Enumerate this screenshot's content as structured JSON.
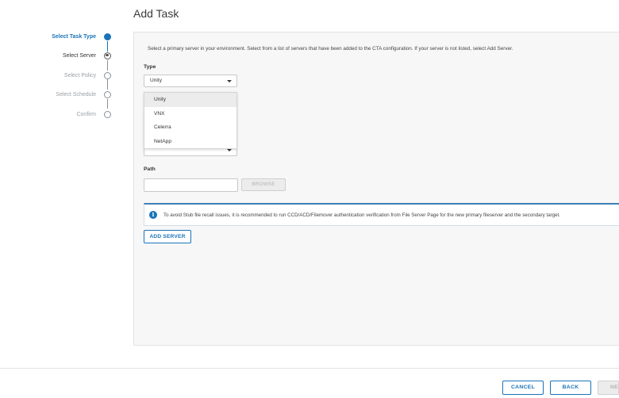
{
  "page": {
    "title": "Add Task"
  },
  "stepper": {
    "steps": [
      {
        "label": "Select Task Type",
        "state": "done"
      },
      {
        "label": "Select Server",
        "state": "current"
      },
      {
        "label": "Select Policy",
        "state": "pending"
      },
      {
        "label": "Select Schedule",
        "state": "pending"
      },
      {
        "label": "Confirm",
        "state": "pending"
      }
    ]
  },
  "form": {
    "intro": "Select a primary server in your environment. Select from a list of servers that have been added to the CTA configuration. If your server is not listed, select Add Server.",
    "type_label": "Type",
    "type_value": "Unity",
    "type_options": [
      "Unity",
      "VNX",
      "Celerra",
      "NetApp"
    ],
    "path_label": "Path",
    "path_value": "",
    "browse_label": "BROWSE",
    "info_text": "To avoid Stub file recall issues, it is recommended to run CCD/ACD/Filemover authentication verification from File Server Page for the new primary fileserver and the secondary target.",
    "add_server_label": "ADD SERVER"
  },
  "footer": {
    "cancel_label": "CANCEL",
    "back_label": "BACK",
    "next_label": "NE"
  },
  "colors": {
    "accent": "#1a73b8"
  }
}
